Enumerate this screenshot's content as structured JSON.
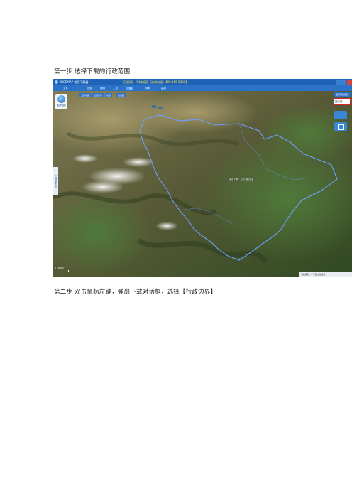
{
  "doc": {
    "step1": "第一步 选择下载的行政范围",
    "step2": "第二步 双击鼠标左键，弹出下载对话框，选择【行政边界】"
  },
  "app": {
    "title": "BIGEMAP 地图下载器",
    "title_extra": "【已授权 - 所有地图】【咨询电话：400-118-5430】",
    "menu": [
      "文件",
      "视图",
      "编辑",
      "工具",
      "下载",
      "帮助",
      "高级"
    ],
    "logo_label": "谷歌地图",
    "subtool": [
      "卫星地图",
      "卫星影像",
      "地形",
      "街道图"
    ],
    "panel_header": "选择行政区划",
    "region_input": "四川省",
    "left_tab": "下载任务列表",
    "map_label": "双击下载：四川省范围",
    "scale_text": "0 100km",
    "status_text": "当前级别：7 下载 当前坐标"
  },
  "colors": {
    "boundary": "#6fa0ff",
    "accent": "#1e63b8",
    "highlight": "#e0202a"
  }
}
